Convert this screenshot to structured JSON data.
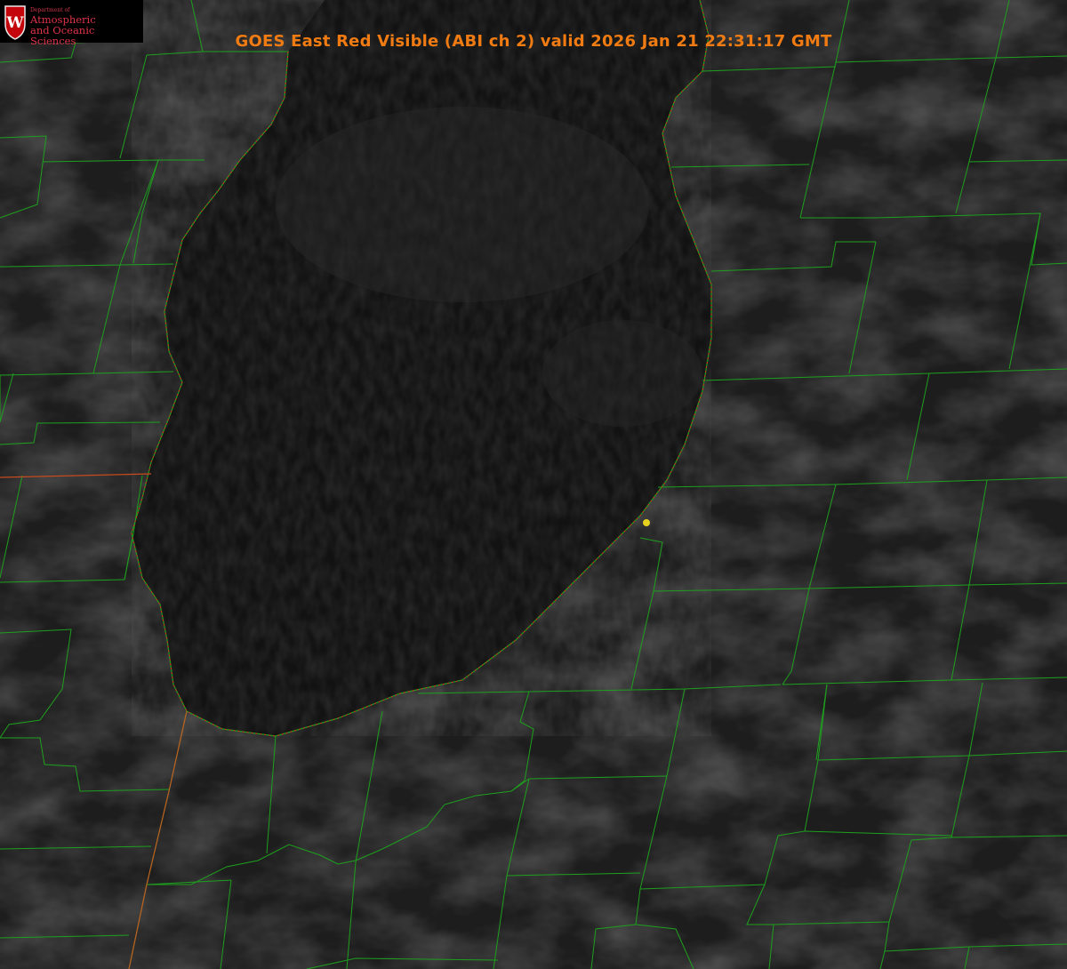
{
  "title": "GOES East Red Visible (ABI ch 2) valid 2026 Jan 21 22:31:17 GMT",
  "logo": {
    "department": "Department of",
    "line1": "Atmospheric",
    "line2": "and Oceanic Sciences",
    "seal_letter": "W"
  },
  "colors": {
    "background": "#1c1c1c",
    "lake": "#141414",
    "county_lines": "#1ea01e",
    "coastline": "#e02020",
    "title": "#f07b12",
    "logo_red": "#c5050c",
    "marker": "#e6d21e"
  },
  "layers": [
    "satellite-visible-imagery",
    "county-boundaries",
    "lake-shoreline",
    "station-marker"
  ]
}
